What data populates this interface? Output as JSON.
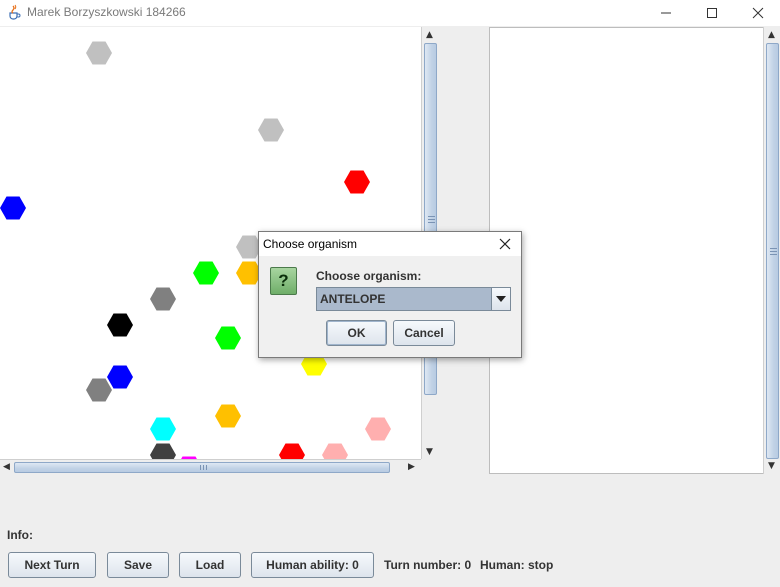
{
  "window": {
    "title": "Marek Borzyszkowski 184266",
    "app_icon": "java-cup-icon",
    "controls": [
      "minimize-icon",
      "maximize-icon",
      "close-icon"
    ]
  },
  "board": {
    "organisms": [
      {
        "color": "#c0c0c0"
      },
      {
        "color": "#c0c0c0"
      },
      {
        "color": "#ff0000"
      },
      {
        "color": "#0000ff"
      },
      {
        "color": "#c0c0c0"
      },
      {
        "color": "#00ff00"
      },
      {
        "color": "#ffc000"
      },
      {
        "color": "#808080"
      },
      {
        "color": "#000000"
      },
      {
        "color": "#00ff00"
      },
      {
        "color": "#ffff00"
      },
      {
        "color": "#0000ff"
      },
      {
        "color": "#808080"
      },
      {
        "color": "#ffc000"
      },
      {
        "color": "#00ffff"
      },
      {
        "color": "#ffafaf"
      },
      {
        "color": "#404040"
      },
      {
        "color": "#ff00ff"
      },
      {
        "color": "#ff0000"
      },
      {
        "color": "#ffafaf"
      }
    ]
  },
  "info": {
    "label": "Info:"
  },
  "controls": {
    "next_turn": "Next Turn",
    "save": "Save",
    "load": "Load",
    "human_ability": "Human ability: 0",
    "turn_number": "Turn number: 0",
    "human_status": "Human: stop"
  },
  "dialog": {
    "title": "Choose organism",
    "icon": "question-icon",
    "icon_glyph": "?",
    "message": "Choose organism:",
    "selected": "ANTELOPE",
    "ok": "OK",
    "cancel": "Cancel"
  }
}
